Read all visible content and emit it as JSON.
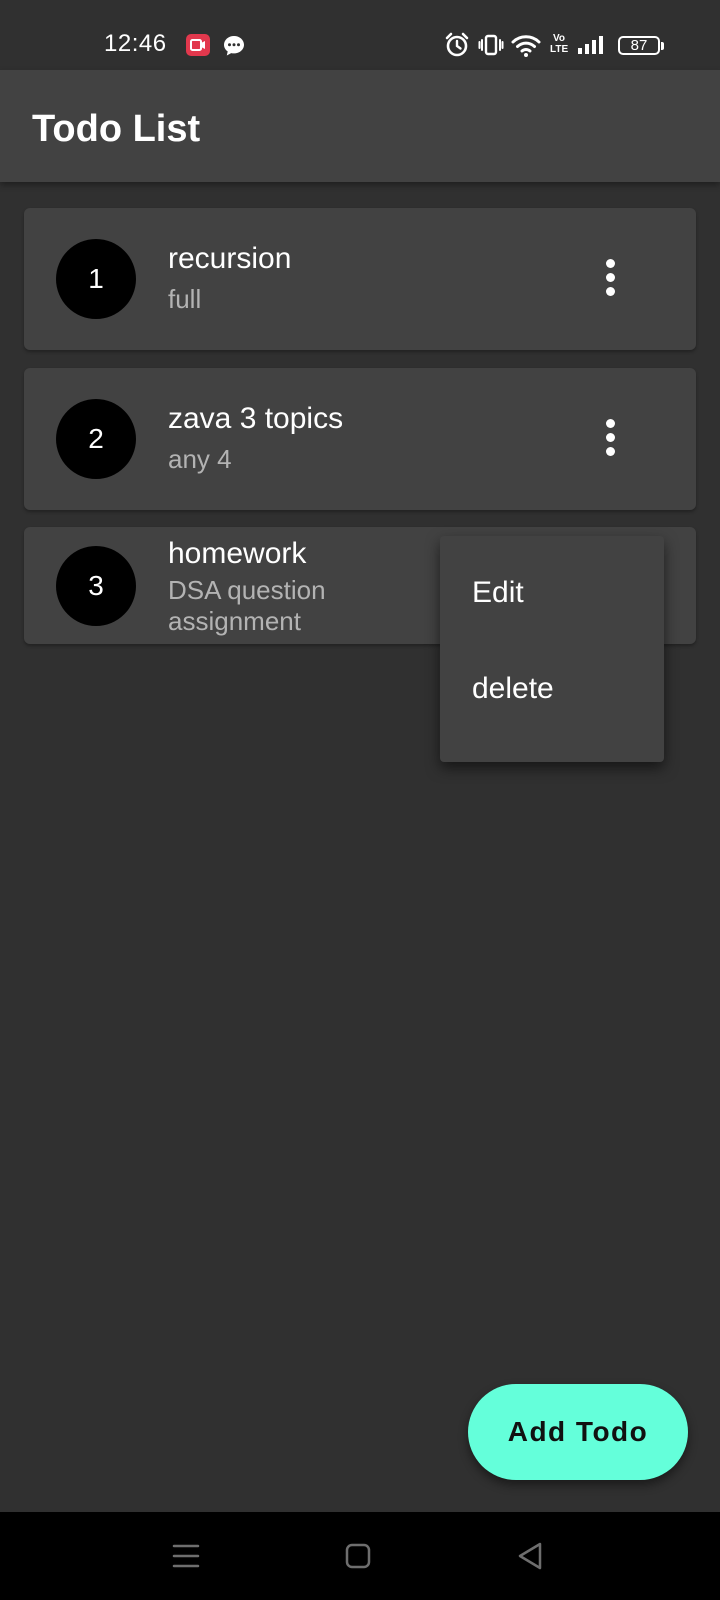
{
  "status_bar": {
    "time": "12:46",
    "battery": "87",
    "icons": [
      "screen-record-icon",
      "message-icon",
      "alarm-icon",
      "vibrate-icon",
      "wifi-icon",
      "volte-icon",
      "signal-icon",
      "battery-icon"
    ],
    "volte_line1": "Vo",
    "volte_line2": "LTE"
  },
  "app_bar": {
    "title": "Todo List"
  },
  "todos": [
    {
      "number": "1",
      "title": "recursion",
      "subtitle": "full"
    },
    {
      "number": "2",
      "title": "zava 3 topics",
      "subtitle": "any 4"
    },
    {
      "number": "3",
      "title": "homework",
      "subtitle": "DSA question assignment"
    }
  ],
  "popup_menu": {
    "items": [
      {
        "label": "Edit"
      },
      {
        "label": "delete"
      }
    ]
  },
  "fab": {
    "label": "Add Todo",
    "color": "#64ffda"
  },
  "nav_bar": {
    "icons": [
      "recents-icon",
      "home-icon",
      "back-icon"
    ]
  },
  "colors": {
    "background": "#303030",
    "surface": "#424242",
    "avatar": "#000000",
    "subtitle": "#b3b3b3"
  }
}
